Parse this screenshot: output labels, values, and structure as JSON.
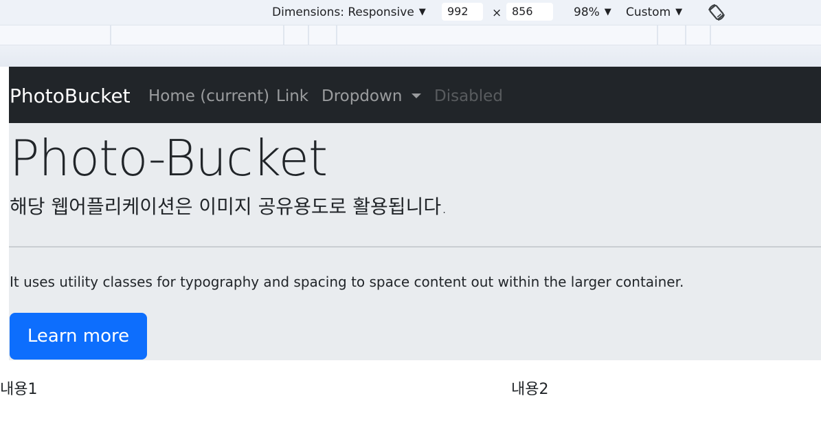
{
  "devtools": {
    "dimensions_label": "Dimensions: Responsive",
    "width_value": "992",
    "height_value": "856",
    "times_symbol": "×",
    "zoom_label": "98%",
    "throttle_label": "Custom"
  },
  "navbar": {
    "brand": "PhotoBucket",
    "links": [
      {
        "label": "Home (current)"
      },
      {
        "label": "Link"
      },
      {
        "label": "Dropdown"
      },
      {
        "label": "Disabled"
      }
    ]
  },
  "jumbotron": {
    "title": "Photo-Bucket",
    "lead": "해당 웹어플리케이션은 이미지 공유용도로 활용됩니다.",
    "text": "It uses utility classes for typography and spacing to space content out within the larger container.",
    "button_label": "Learn more"
  },
  "columns": [
    {
      "text": "내용1"
    },
    {
      "text": "내용2"
    }
  ],
  "colors": {
    "navbar_bg": "#212529",
    "jumbotron_bg": "#e9ecef",
    "primary": "#0d6efd"
  }
}
